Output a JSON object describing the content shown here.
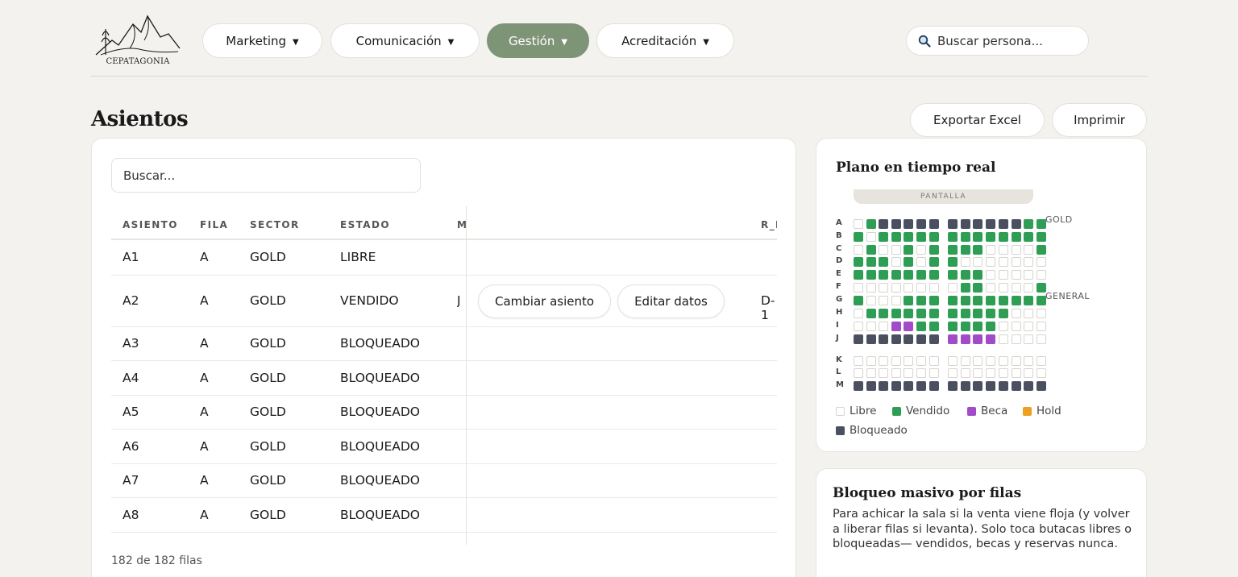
{
  "brand": {
    "name": "CEPATAGONIA"
  },
  "nav": [
    {
      "label": "Marketing",
      "active": false
    },
    {
      "label": "Comunicación",
      "active": false
    },
    {
      "label": "Gestión",
      "active": true
    },
    {
      "label": "Acreditación",
      "active": false
    }
  ],
  "nav_caret": "▼",
  "top_search": {
    "placeholder": "Buscar persona..."
  },
  "page": {
    "title": "Asientos",
    "export_label": "Exportar Excel",
    "print_label": "Imprimir"
  },
  "table": {
    "search_placeholder": "Buscar...",
    "columns": [
      "ASIENTO",
      "FILA",
      "SECTOR",
      "ESTADO",
      "M",
      "R_I"
    ],
    "rows": [
      {
        "asiento": "A1",
        "fila": "A",
        "sector": "GOLD",
        "estado": "LIBRE",
        "m": "",
        "r": ""
      },
      {
        "asiento": "A2",
        "fila": "A",
        "sector": "GOLD",
        "estado": "VENDIDO",
        "m": "J",
        "r": "D-1"
      },
      {
        "asiento": "A3",
        "fila": "A",
        "sector": "GOLD",
        "estado": "BLOQUEADO",
        "m": "",
        "r": ""
      },
      {
        "asiento": "A4",
        "fila": "A",
        "sector": "GOLD",
        "estado": "BLOQUEADO",
        "m": "",
        "r": ""
      },
      {
        "asiento": "A5",
        "fila": "A",
        "sector": "GOLD",
        "estado": "BLOQUEADO",
        "m": "",
        "r": ""
      },
      {
        "asiento": "A6",
        "fila": "A",
        "sector": "GOLD",
        "estado": "BLOQUEADO",
        "m": "",
        "r": ""
      },
      {
        "asiento": "A7",
        "fila": "A",
        "sector": "GOLD",
        "estado": "BLOQUEADO",
        "m": "",
        "r": ""
      },
      {
        "asiento": "A8",
        "fila": "A",
        "sector": "GOLD",
        "estado": "BLOQUEADO",
        "m": "",
        "r": ""
      }
    ],
    "row_actions": {
      "change_seat": "Cambiar asiento",
      "edit_data": "Editar datos"
    },
    "footer": "182 de 182 filas"
  },
  "seat_map": {
    "title": "Plano en tiempo real",
    "screen_label": "PANTALLA",
    "sectors": [
      "GOLD",
      "GENERAL"
    ],
    "colors": {
      "L": "#ffffff",
      "V": "#2f9e55",
      "B": "#a24bc8",
      "H": "#f0a020",
      "X": "#4a5060"
    },
    "rows": [
      {
        "letter": "A",
        "seats": "LVXXXXXXXXXXXVV"
      },
      {
        "letter": "B",
        "seats": "VLVVVVVVVVVVVVV"
      },
      {
        "letter": "C",
        "seats": "LVLLVLVVVVLLLLV"
      },
      {
        "letter": "D",
        "seats": "VVVLVLVVLLLLLLL"
      },
      {
        "letter": "E",
        "seats": "VVVVVVVVVVLLLLL"
      },
      {
        "letter": "F",
        "seats": "LLLLLLLLVVLLLLV"
      },
      {
        "letter": "G",
        "seats": "VLLLVVVVVVVVVVV"
      },
      {
        "letter": "H",
        "seats": "LVVVVVVVVVVVLLL"
      },
      {
        "letter": "I",
        "seats": "LLLBBVVVVVVLLLL"
      },
      {
        "letter": "J",
        "seats": "XXXXXXXBBBBLLLL"
      },
      {
        "letter": "K",
        "seats": "LLLLLLLLLLLLLLL"
      },
      {
        "letter": "L",
        "seats": "LLLLLLLLLLLLLLL"
      },
      {
        "letter": "M",
        "seats": "XXXXXXXXXXXXXXX"
      }
    ],
    "legend": [
      {
        "key": "L",
        "label": "Libre"
      },
      {
        "key": "V",
        "label": "Vendido"
      },
      {
        "key": "B",
        "label": "Beca"
      },
      {
        "key": "H",
        "label": "Hold"
      },
      {
        "key": "X",
        "label": "Bloqueado"
      }
    ]
  },
  "bulk": {
    "title": "Bloqueo masivo por filas",
    "description": "Para achicar la sala si la venta viene floja (y volver a liberar filas si levanta). Solo toca butacas libres o bloqueadas— vendidos, becas y reservas nunca."
  }
}
